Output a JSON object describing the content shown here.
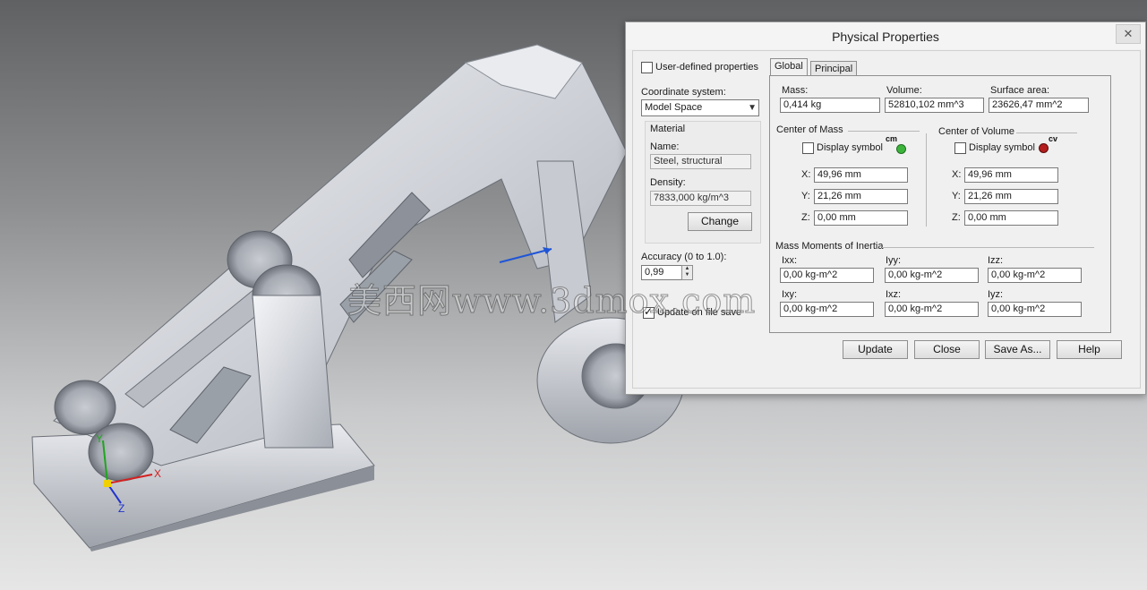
{
  "dialog": {
    "title": "Physical Properties",
    "close_icon": "✕",
    "user_defined_label": "User-defined properties",
    "coord_system_label": "Coordinate system:",
    "coord_system_value": "Model Space",
    "material": {
      "heading": "Material",
      "name_label": "Name:",
      "name_value": "Steel, structural",
      "density_label": "Density:",
      "density_value": "7833,000 kg/m^3",
      "change_label": "Change"
    },
    "accuracy_label": "Accuracy (0 to 1.0):",
    "accuracy_value": "0,99",
    "update_on_save_label": "Update on file save",
    "tabs": [
      "Global",
      "Principal"
    ],
    "mass_label": "Mass:",
    "mass_value": "0,414 kg",
    "volume_label": "Volume:",
    "volume_value": "52810,102 mm^3",
    "surface_label": "Surface area:",
    "surface_value": "23626,47 mm^2",
    "com": {
      "heading": "Center of Mass",
      "display_symbol": "Display symbol",
      "symbol_text": "cm",
      "x_label": "X:",
      "x": "49,96 mm",
      "y_label": "Y:",
      "y": "21,26 mm",
      "z_label": "Z:",
      "z": "0,00 mm"
    },
    "cov": {
      "heading": "Center of Volume",
      "display_symbol": "Display symbol",
      "symbol_text": "cv",
      "x_label": "X:",
      "x": "49,96 mm",
      "y_label": "Y:",
      "y": "21,26 mm",
      "z_label": "Z:",
      "z": "0,00 mm"
    },
    "inertia": {
      "heading": "Mass Moments of Inertia",
      "ixx_label": "Ixx:",
      "ixx": "0,00 kg-m^2",
      "iyy_label": "Iyy:",
      "iyy": "0,00 kg-m^2",
      "izz_label": "Izz:",
      "izz": "0,00 kg-m^2",
      "ixy_label": "Ixy:",
      "ixy": "0,00 kg-m^2",
      "ixz_label": "Ixz:",
      "ixz": "0,00 kg-m^2",
      "iyz_label": "Iyz:",
      "iyz": "0,00 kg-m^2"
    },
    "buttons": {
      "update": "Update",
      "close": "Close",
      "save_as": "Save As...",
      "help": "Help"
    }
  },
  "watermark": "美西网www.3dmox.com",
  "triad": {
    "x_label": "X",
    "y_label": "Y",
    "z_label": "Z"
  }
}
